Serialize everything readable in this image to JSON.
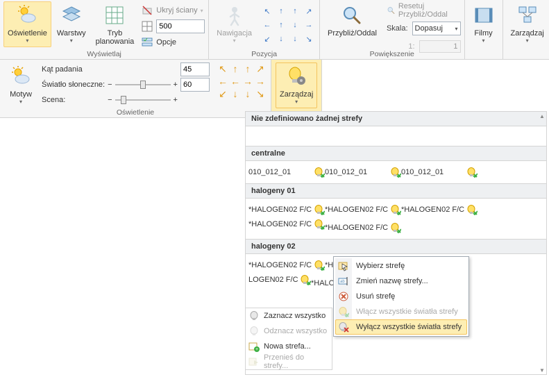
{
  "ribbon": {
    "lighting": "Oświetlenie",
    "layers": "Warstwy",
    "planmode": "Tryb\nplanowania",
    "hidewalls": "Ukryj ściany",
    "options": "Opcje",
    "display_group": "Wyświetlaj",
    "nav": "Nawigacja",
    "position_group": "Pozycja",
    "zoom_btn": "Przybliż/Oddal",
    "reset_zoom": "Resetuj Przybliż/Oddal",
    "scale": "Skala:",
    "scale_value": "Dopasuj",
    "scale_unit_1": "1:",
    "scale_readonly": "1",
    "zoom_group": "Powiększenie",
    "movies": "Filmy",
    "manage": "Zarządzaj",
    "grid_input": "500"
  },
  "subribbon": {
    "theme": "Motyw",
    "angle": "Kąt padania",
    "sunlight": "Światło słoneczne:",
    "scene": "Scena:",
    "angle_val": "45",
    "sun_val": "60",
    "group": "Oświetlenie",
    "manage": "Zarządzaj"
  },
  "panel": {
    "zone_none": "Nie zdefiniowano żadnej strefy",
    "zone_central": "centralne",
    "zone_h1": "halogeny 01",
    "zone_h2": "halogeny 02",
    "light_central": "010_012_01",
    "light_halogen": "*HALOGEN02 F/C",
    "light_halogen_cut": "*HAL",
    "light_logen_cut": "LOGEN02 F/C"
  },
  "actions": {
    "select_all": "Zaznacz wszystko",
    "deselect_all": "Odznacz wszystko",
    "new_zone": "Nowa strefa...",
    "move_to_zone": "Przenieś do strefy..."
  },
  "context": {
    "select_zone": "Wybierz strefę",
    "rename_zone": "Zmień nazwę strefy...",
    "delete_zone": "Usuń strefę",
    "all_on": "Włącz wszystkie światła strefy",
    "all_off": "Wyłącz wszystkie światła strefy"
  },
  "colors": {
    "arrow_blue": "#3d78c7",
    "arrow_orange": "#e09a1a",
    "bulb_yellow": "#f4c430",
    "bulb_green": "#3cb043"
  }
}
